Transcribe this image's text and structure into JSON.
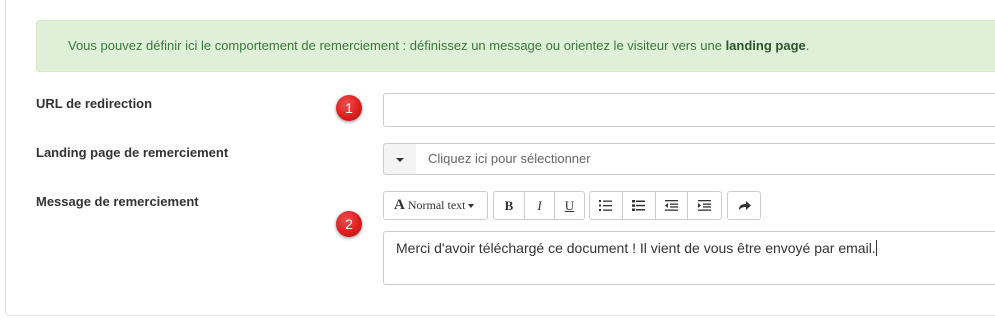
{
  "alert": {
    "text_before": "Vous pouvez définir ici le comportement de remerciement : définissez un message ou orientez le visiteur vers une ",
    "bold_text": "landing page",
    "text_after": "."
  },
  "fields": {
    "redirect_url": {
      "label": "URL de redirection",
      "value": ""
    },
    "landing_page": {
      "label": "Landing page de remerciement",
      "placeholder": "Cliquez ici pour sélectionner"
    },
    "thank_you_message": {
      "label": "Message de remerciement",
      "value": "Merci d'avoir téléchargé ce document ! Il vient de vous être envoyé par email."
    }
  },
  "markers": [
    "1",
    "2"
  ],
  "toolbar": {
    "format_icon": "A",
    "format_label": "Normal text",
    "bold": "B",
    "italic": "I",
    "underline": "U",
    "icons": [
      "unordered-list-icon",
      "ordered-list-icon",
      "outdent-icon",
      "indent-icon",
      "redo-icon"
    ]
  },
  "colors": {
    "alert_bg": "#dff0d8",
    "alert_text": "#3c763d",
    "marker": "#dc1f1f"
  }
}
